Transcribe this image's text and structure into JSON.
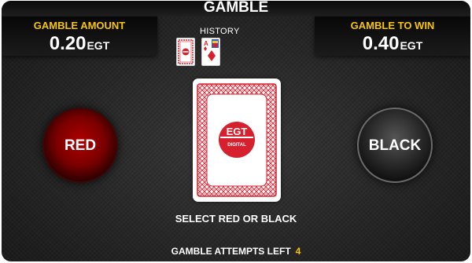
{
  "title": "GAMBLE",
  "gamble_amount": {
    "label": "GAMBLE AMOUNT",
    "value": "0.20",
    "currency": "EGT"
  },
  "gamble_to_win": {
    "label": "GAMBLE TO WIN",
    "value": "0.40",
    "currency": "EGT"
  },
  "history": {
    "label": "HISTORY",
    "cards": [
      {
        "type": "card-back"
      },
      {
        "type": "face",
        "rank": "A",
        "suit": "diamonds"
      }
    ]
  },
  "card": {
    "logo_top": "EGT",
    "logo_bottom": "DIGITAL"
  },
  "buttons": {
    "red_label": "RED",
    "black_label": "BLACK"
  },
  "prompt": "SELECT RED OR BLACK",
  "attempts": {
    "label": "GAMBLE ATTEMPTS LEFT",
    "count": "4"
  },
  "colors": {
    "accent_yellow": "#f7c600",
    "card_red": "#d6202e"
  }
}
